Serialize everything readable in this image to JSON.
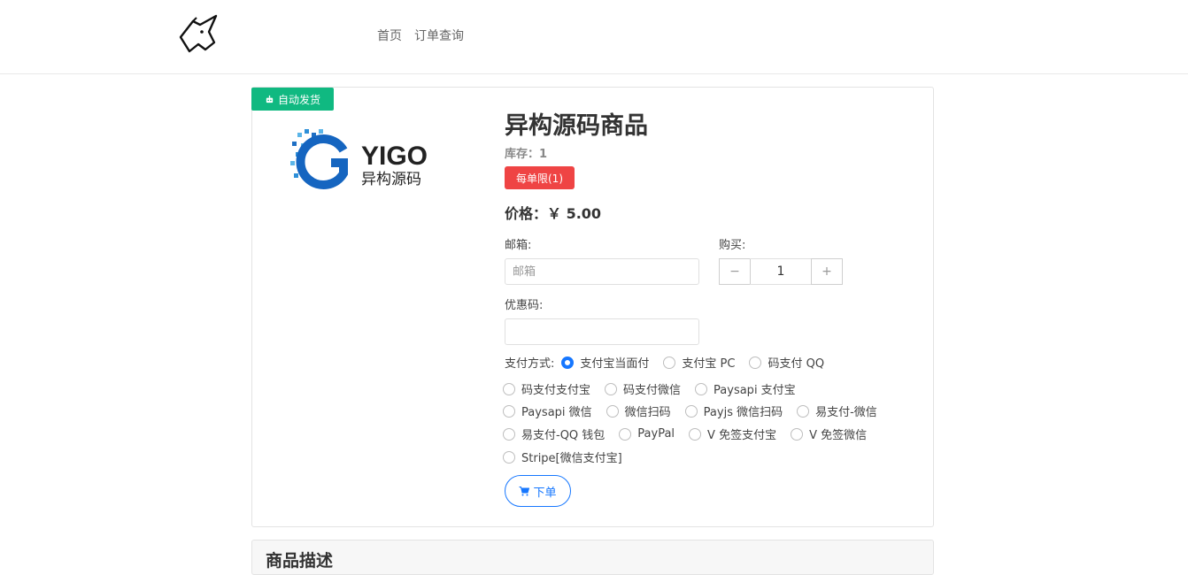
{
  "nav": {
    "items": [
      "首页",
      "订单查询"
    ]
  },
  "product": {
    "ribbon": "自动发货",
    "image_text": {
      "brand": "YIGO",
      "cn": "异构源码"
    },
    "title": "异构源码商品",
    "stock": "库存：1",
    "limit": "每单限(1)",
    "price": "价格：￥ 5.00"
  },
  "form": {
    "email_label": "邮箱:",
    "email_placeholder": "邮箱",
    "buy_label": "购买:",
    "quantity": "1",
    "minus": "−",
    "plus": "+",
    "coupon_label": "优惠码:",
    "coupon_value": ""
  },
  "payment": {
    "label": "支付方式:",
    "options": [
      "支付宝当面付",
      "支付宝 PC",
      "码支付 QQ",
      "码支付支付宝",
      "码支付微信",
      "Paysapi 支付宝",
      "Paysapi 微信",
      "微信扫码",
      "Payjs 微信扫码",
      "易支付-微信",
      "易支付-QQ 钱包",
      "PayPal",
      "V 免签支付宝",
      "V 免签微信",
      "Stripe[微信支付宝]"
    ],
    "selected": 0
  },
  "order_button": "下单",
  "description": {
    "title": "商品描述"
  },
  "colors": {
    "accent": "#1677ff",
    "ribbon": "#10b981",
    "badge": "#ef4444"
  }
}
